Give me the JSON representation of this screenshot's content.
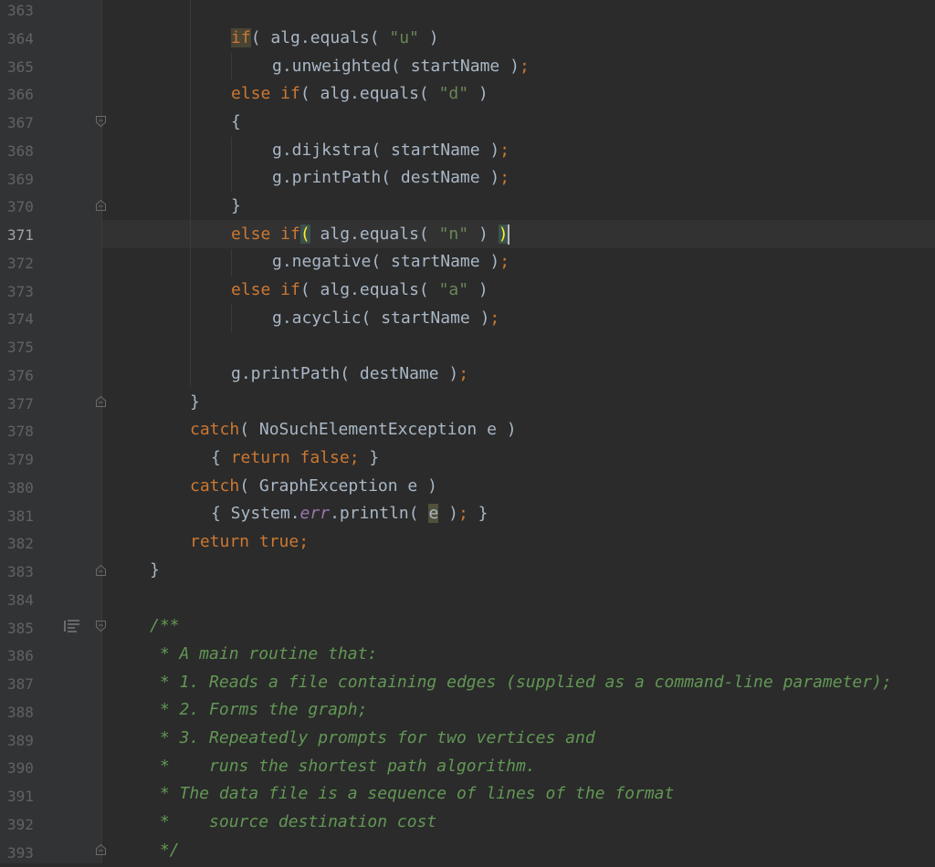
{
  "editor": {
    "current_line": "371",
    "line_numbers": [
      "363",
      "364",
      "365",
      "366",
      "367",
      "368",
      "369",
      "370",
      "371",
      "372",
      "373",
      "374",
      "375",
      "376",
      "377",
      "378",
      "379",
      "380",
      "381",
      "382",
      "383",
      "384",
      "385",
      "386",
      "387",
      "388",
      "389",
      "390",
      "391",
      "392",
      "393"
    ],
    "code": {
      "l364": {
        "kw": "if",
        "rest": "( alg.equals( ",
        "str": "\"u\"",
        "end": " )"
      },
      "l365": {
        "a": "g.unweighted( startName )",
        "semi": ";"
      },
      "l366": {
        "kw": "else if",
        "rest": "( alg.equals( ",
        "str": "\"d\"",
        "end": " )"
      },
      "l367": {
        "a": "{"
      },
      "l368": {
        "a": "g.dijkstra( startName )",
        "semi": ";"
      },
      "l369": {
        "a": "g.printPath( destName )",
        "semi": ";"
      },
      "l370": {
        "a": "}"
      },
      "l371": {
        "kw": "else if",
        "br1": "(",
        "rest": " alg.equals( ",
        "str": "\"n\"",
        "mid": " ) ",
        "br2": ")"
      },
      "l372": {
        "a": "g.negative( startName )",
        "semi": ";"
      },
      "l373": {
        "kw": "else if",
        "rest": "( alg.equals( ",
        "str": "\"a\"",
        "end": " )"
      },
      "l374": {
        "a": "g.acyclic( startName )",
        "semi": ";"
      },
      "l376": {
        "a": "g.printPath( destName )",
        "semi": ";"
      },
      "l377": {
        "a": "}"
      },
      "l378": {
        "kw": "catch",
        "rest": "( NoSuchElementException e )"
      },
      "l379": {
        "a": "{ ",
        "kw": "return false",
        "semi": ";",
        "end": " }"
      },
      "l380": {
        "kw": "catch",
        "rest": "( GraphException e )"
      },
      "l381": {
        "a": "{ System.",
        "fld": "err",
        "b": ".println( ",
        "e": "e",
        "c": " )",
        "semi": ";",
        "end": " }"
      },
      "l382": {
        "kw": "return true",
        "semi": ";"
      },
      "l383": {
        "a": "}"
      },
      "l385": "/**",
      "l386": " * A main routine that:",
      "l387": " * 1. Reads a file containing edges (supplied as a command-line parameter);",
      "l388": " * 2. Forms the graph;",
      "l389": " * 3. Repeatedly prompts for two vertices and",
      "l390": " *    runs the shortest path algorithm.",
      "l391": " * The data file is a sequence of lines of the format",
      "l392": " *    source destination cost",
      "l393": " */"
    },
    "colors": {
      "background": "#2b2b2b",
      "gutter": "#313335",
      "keyword": "#cc7832",
      "string": "#6a8759",
      "comment": "#629755",
      "field": "#9876aa",
      "text": "#a9b7c6"
    }
  }
}
